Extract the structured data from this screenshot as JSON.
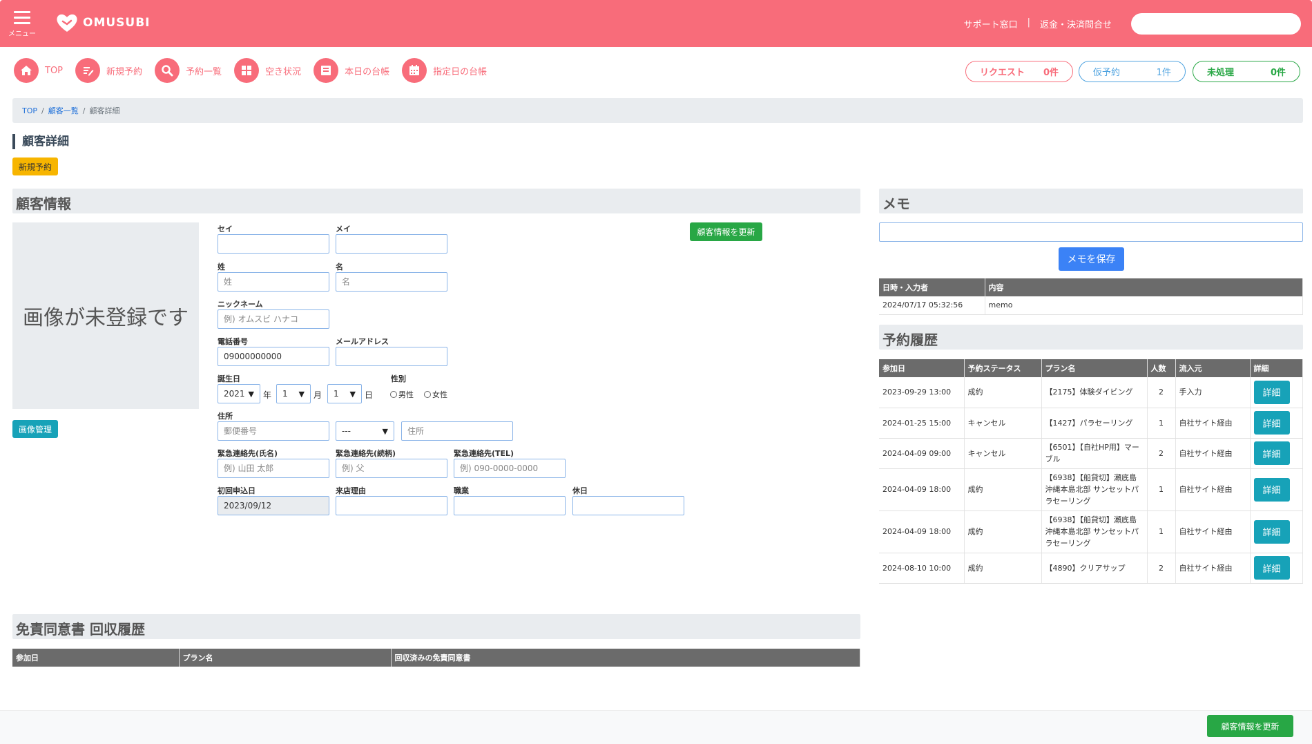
{
  "header": {
    "menu_label": "メニュー",
    "logo_text": "OMUSUBI",
    "links": [
      "サポート窓口",
      "返金・決済問合せ"
    ],
    "link_sep": "|",
    "brand_color": "#f86c7a"
  },
  "nav": {
    "items": [
      {
        "label": "TOP",
        "icon": "home-icon"
      },
      {
        "label": "新規予約",
        "icon": "edit-icon"
      },
      {
        "label": "予約一覧",
        "icon": "search-icon"
      },
      {
        "label": "空き状況",
        "icon": "grid-icon"
      },
      {
        "label": "本日の台帳",
        "icon": "book-icon"
      },
      {
        "label": "指定日の台帳",
        "icon": "calendar-icon"
      }
    ],
    "pills": [
      {
        "label": "リクエスト",
        "count": "0件",
        "color": "#f86c7a"
      },
      {
        "label": "仮予約",
        "count": "1件",
        "color": "#4fa3e0"
      },
      {
        "label": "未処理",
        "count": "0件",
        "color": "#28a745"
      }
    ]
  },
  "breadcrumb": {
    "items": [
      "TOP",
      "顧客一覧",
      "顧客詳細"
    ],
    "sep": "/"
  },
  "page_title": "顧客詳細",
  "new_reservation_button": "新規予約",
  "customer": {
    "section_title": "顧客情報",
    "no_image_text": "画像が未登録です",
    "image_button": "画像管理",
    "update_button": "顧客情報を更新",
    "fields": {
      "sei": {
        "label": "セイ",
        "value": "",
        "placeholder": ""
      },
      "mei": {
        "label": "メイ",
        "value": "",
        "placeholder": ""
      },
      "last_name": {
        "label": "姓",
        "value": "",
        "placeholder": "姓"
      },
      "first_name": {
        "label": "名",
        "value": "",
        "placeholder": "名"
      },
      "nickname": {
        "label": "ニックネーム",
        "value": "",
        "placeholder": "例) オムスビ ハナコ"
      },
      "phone": {
        "label": "電話番号",
        "value": "09000000000",
        "placeholder": ""
      },
      "email": {
        "label": "メールアドレス",
        "value": "",
        "placeholder": ""
      },
      "birthday": {
        "label": "誕生日",
        "year": "2021",
        "year_unit": "年",
        "month": "1",
        "month_unit": "月",
        "day": "1",
        "day_unit": "日"
      },
      "gender": {
        "label": "性別",
        "options": [
          "男性",
          "女性"
        ]
      },
      "address": {
        "label": "住所",
        "postal_placeholder": "郵便番号",
        "prefecture": "---",
        "address_placeholder": "住所"
      },
      "emergency_name": {
        "label": "緊急連絡先(氏名)",
        "placeholder": "例) 山田 太郎"
      },
      "emergency_relation": {
        "label": "緊急連絡先(続柄)",
        "placeholder": "例) 父"
      },
      "emergency_tel": {
        "label": "緊急連絡先(TEL)",
        "placeholder": "例) 090-0000-0000"
      },
      "first_apply": {
        "label": "初回申込日",
        "value": "2023/09/12"
      },
      "visit_reason": {
        "label": "来店理由",
        "value": ""
      },
      "occupation": {
        "label": "職業",
        "value": ""
      },
      "holiday": {
        "label": "休日",
        "value": ""
      }
    }
  },
  "waiver": {
    "section_title": "免責同意書 回収履歴",
    "columns": [
      "参加日",
      "プラン名",
      "回収済みの免責同意書"
    ]
  },
  "memo": {
    "section_title": "メモ",
    "save_button": "メモを保存",
    "columns": [
      "日時・入力者",
      "内容"
    ],
    "rows": [
      [
        "2024/07/17 05:32:56",
        "memo"
      ]
    ]
  },
  "history": {
    "section_title": "予約履歴",
    "columns": [
      "参加日",
      "予約ステータス",
      "プラン名",
      "人数",
      "流入元",
      "詳細"
    ],
    "detail_label": "詳細",
    "rows": [
      {
        "date": "2023-09-29 13:00",
        "status": "成約",
        "plan": "【2175】体験ダイビング",
        "people": "2",
        "source": "手入力"
      },
      {
        "date": "2024-01-25 15:00",
        "status": "キャンセル",
        "plan": "【1427】パラセーリング",
        "people": "1",
        "source": "自社サイト経由"
      },
      {
        "date": "2024-04-09 09:00",
        "status": "キャンセル",
        "plan": "【6501】【自社HP用】マーブル",
        "people": "2",
        "source": "自社サイト経由"
      },
      {
        "date": "2024-04-09 18:00",
        "status": "成約",
        "plan": "【6938】【船貸切】瀬底島 沖縄本島北部 サンセットパラセーリング",
        "people": "1",
        "source": "自社サイト経由"
      },
      {
        "date": "2024-04-09 18:00",
        "status": "成約",
        "plan": "【6938】【船貸切】瀬底島 沖縄本島北部 サンセットパラセーリング",
        "people": "1",
        "source": "自社サイト経由"
      },
      {
        "date": "2024-08-10 10:00",
        "status": "成約",
        "plan": "【4890】クリアサップ",
        "people": "2",
        "source": "自社サイト経由"
      }
    ]
  },
  "footer": {
    "update_button": "顧客情報を更新"
  }
}
